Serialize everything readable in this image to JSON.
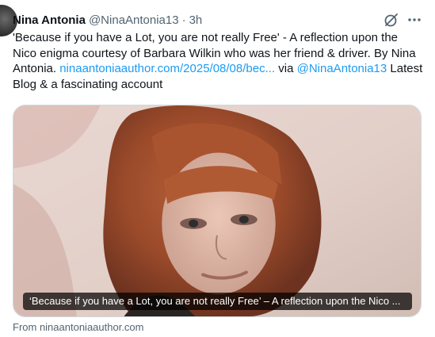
{
  "tweet": {
    "author_name": "Nina Antonia",
    "author_handle": "@NinaAntonia13",
    "separator": "·",
    "timestamp": "3h",
    "text_before_link": "'Because if you have a Lot, you are not really Free' - A reflection upon the Nico enigma courtesy of Barbara Wilkin who was her friend & driver. By Nina Antonia. ",
    "link_url_text": "ninaantoniaauthor.com/2025/08/08/bec...",
    "text_via": " via ",
    "mention": "@NinaAntonia13",
    "text_after_mention": " Latest Blog & a fascinating account"
  },
  "card": {
    "caption": "‘Because if you have a Lot, you are not really Free’ – A reflection upon the Nico ...",
    "source": "From ninaantoniaauthor.com"
  },
  "icons": {
    "avatar": "avatar",
    "grok": "grok-icon",
    "more": "more-icon"
  },
  "colors": {
    "link": "#1d9bf0",
    "secondary_text": "#536471",
    "primary_text": "#0f1419"
  }
}
